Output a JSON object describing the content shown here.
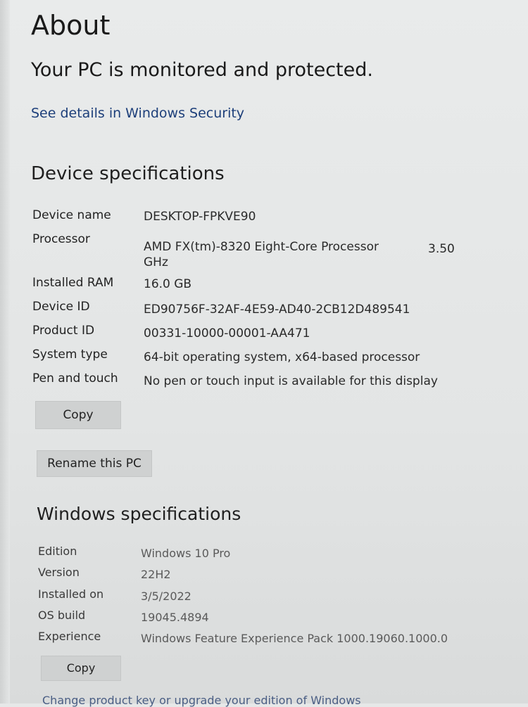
{
  "page": {
    "title": "About",
    "protection_status": "Your PC is monitored and protected.",
    "security_link": "See details in Windows Security"
  },
  "device_specs": {
    "heading": "Device specifications",
    "rows": [
      {
        "label": "Device name",
        "value": "DESKTOP-FPKVE90"
      },
      {
        "label": "Processor",
        "value": "AMD FX(tm)-8320 Eight-Core Processor",
        "value_speed": "3.50",
        "value_unit": "GHz"
      },
      {
        "label": "Installed RAM",
        "value": "16.0 GB"
      },
      {
        "label": "Device ID",
        "value": "ED90756F-32AF-4E59-AD40-2CB12D489541"
      },
      {
        "label": "Product ID",
        "value": "00331-10000-00001-AA471"
      },
      {
        "label": "System type",
        "value": "64-bit operating system, x64-based processor"
      },
      {
        "label": "Pen and touch",
        "value": "No pen or touch input is available for this display"
      }
    ],
    "copy_label": "Copy",
    "rename_label": "Rename this PC"
  },
  "windows_specs": {
    "heading": "Windows specifications",
    "rows": [
      {
        "label": "Edition",
        "value": "Windows 10 Pro"
      },
      {
        "label": "Version",
        "value": "22H2"
      },
      {
        "label": "Installed on",
        "value": "3/5/2022"
      },
      {
        "label": "OS build",
        "value": "19045.4894"
      },
      {
        "label": "Experience",
        "value": "Windows Feature Experience Pack 1000.19060.1000.0"
      }
    ],
    "copy_label": "Copy",
    "footer_link": "Change product key or upgrade your edition of Windows"
  }
}
